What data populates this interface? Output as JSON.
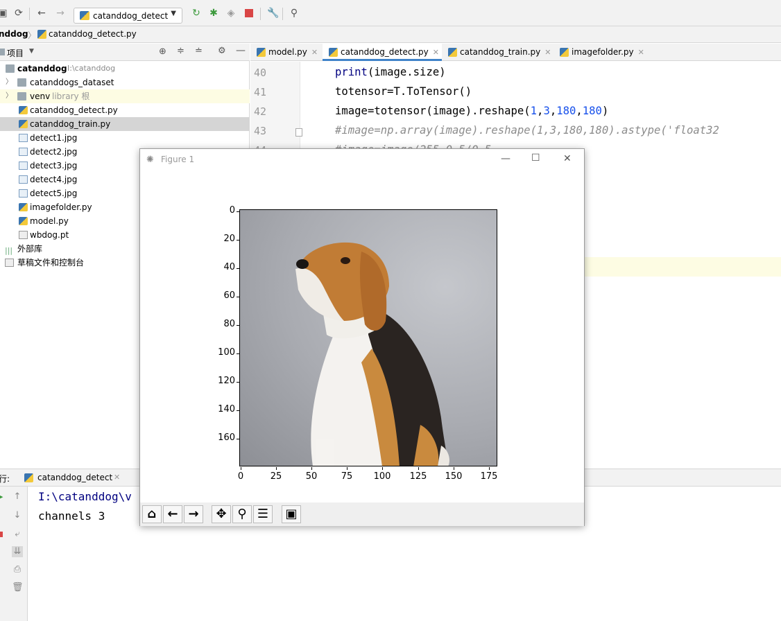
{
  "toolbar": {
    "run_config": "catanddog_detect",
    "icons": [
      "save-icon",
      "sync-icon",
      "back-icon",
      "forward-icon",
      "rerun-icon",
      "debug-icon",
      "coverage-icon",
      "stop-icon",
      "settings-wrench-icon",
      "search-icon"
    ]
  },
  "breadcrumb": {
    "project": "nddog",
    "file": "catanddog_detect.py"
  },
  "project_panel": {
    "title": "项目",
    "root": {
      "name": "catanddog",
      "path": "I:\\catanddog"
    },
    "items": [
      {
        "name": "catanddogs_dataset",
        "kind": "folder"
      },
      {
        "name": "venv",
        "extra": "library 根",
        "kind": "folder"
      },
      {
        "name": "catanddog_detect.py",
        "kind": "py"
      },
      {
        "name": "catanddog_train.py",
        "kind": "py"
      },
      {
        "name": "detect1.jpg",
        "kind": "jpg"
      },
      {
        "name": "detect2.jpg",
        "kind": "jpg"
      },
      {
        "name": "detect3.jpg",
        "kind": "jpg"
      },
      {
        "name": "detect4.jpg",
        "kind": "jpg"
      },
      {
        "name": "detect5.jpg",
        "kind": "jpg"
      },
      {
        "name": "imagefolder.py",
        "kind": "py"
      },
      {
        "name": "model.py",
        "kind": "py"
      },
      {
        "name": "wbdog.pt",
        "kind": "file"
      }
    ],
    "external_libs": "外部库",
    "scratches": "草稿文件和控制台"
  },
  "editor": {
    "tabs": [
      "model.py",
      "catanddog_detect.py",
      "catanddog_train.py",
      "imagefolder.py"
    ],
    "active_tab": 1,
    "line_numbers": [
      "40",
      "41",
      "42",
      "43",
      "44"
    ],
    "lines": {
      "l40_fn": "print",
      "l40_rest": "(image.size)",
      "l41": "totensor=T.ToTensor()",
      "l42_a": "image=totensor(image).reshape(",
      "l42_n1": "1",
      "l42_c1": ",",
      "l42_n2": "3",
      "l42_c2": ",",
      "l42_n3": "180",
      "l42_c3": ",",
      "l42_n4": "180",
      "l42_b": ")",
      "l43": "#image=np.array(image).reshape(1,3,180,180).astype('float32",
      "l44": "#image=image/255-0.5/0.5"
    }
  },
  "run_panel": {
    "label": "行:",
    "tab": "catanddog_detect",
    "console_lines": [
      "I:\\catanddog\\v",
      "channels 3"
    ]
  },
  "figure": {
    "title": "Figure 1",
    "y_ticks": [
      "0",
      "20",
      "40",
      "60",
      "80",
      "100",
      "120",
      "140",
      "160"
    ],
    "x_ticks": [
      "0",
      "25",
      "50",
      "75",
      "100",
      "125",
      "150",
      "175"
    ],
    "toolbar_icons": [
      "home-icon",
      "back-arrow-icon",
      "forward-arrow-icon",
      "pan-icon",
      "zoom-icon",
      "configure-subplots-icon",
      "save-figure-icon"
    ]
  }
}
